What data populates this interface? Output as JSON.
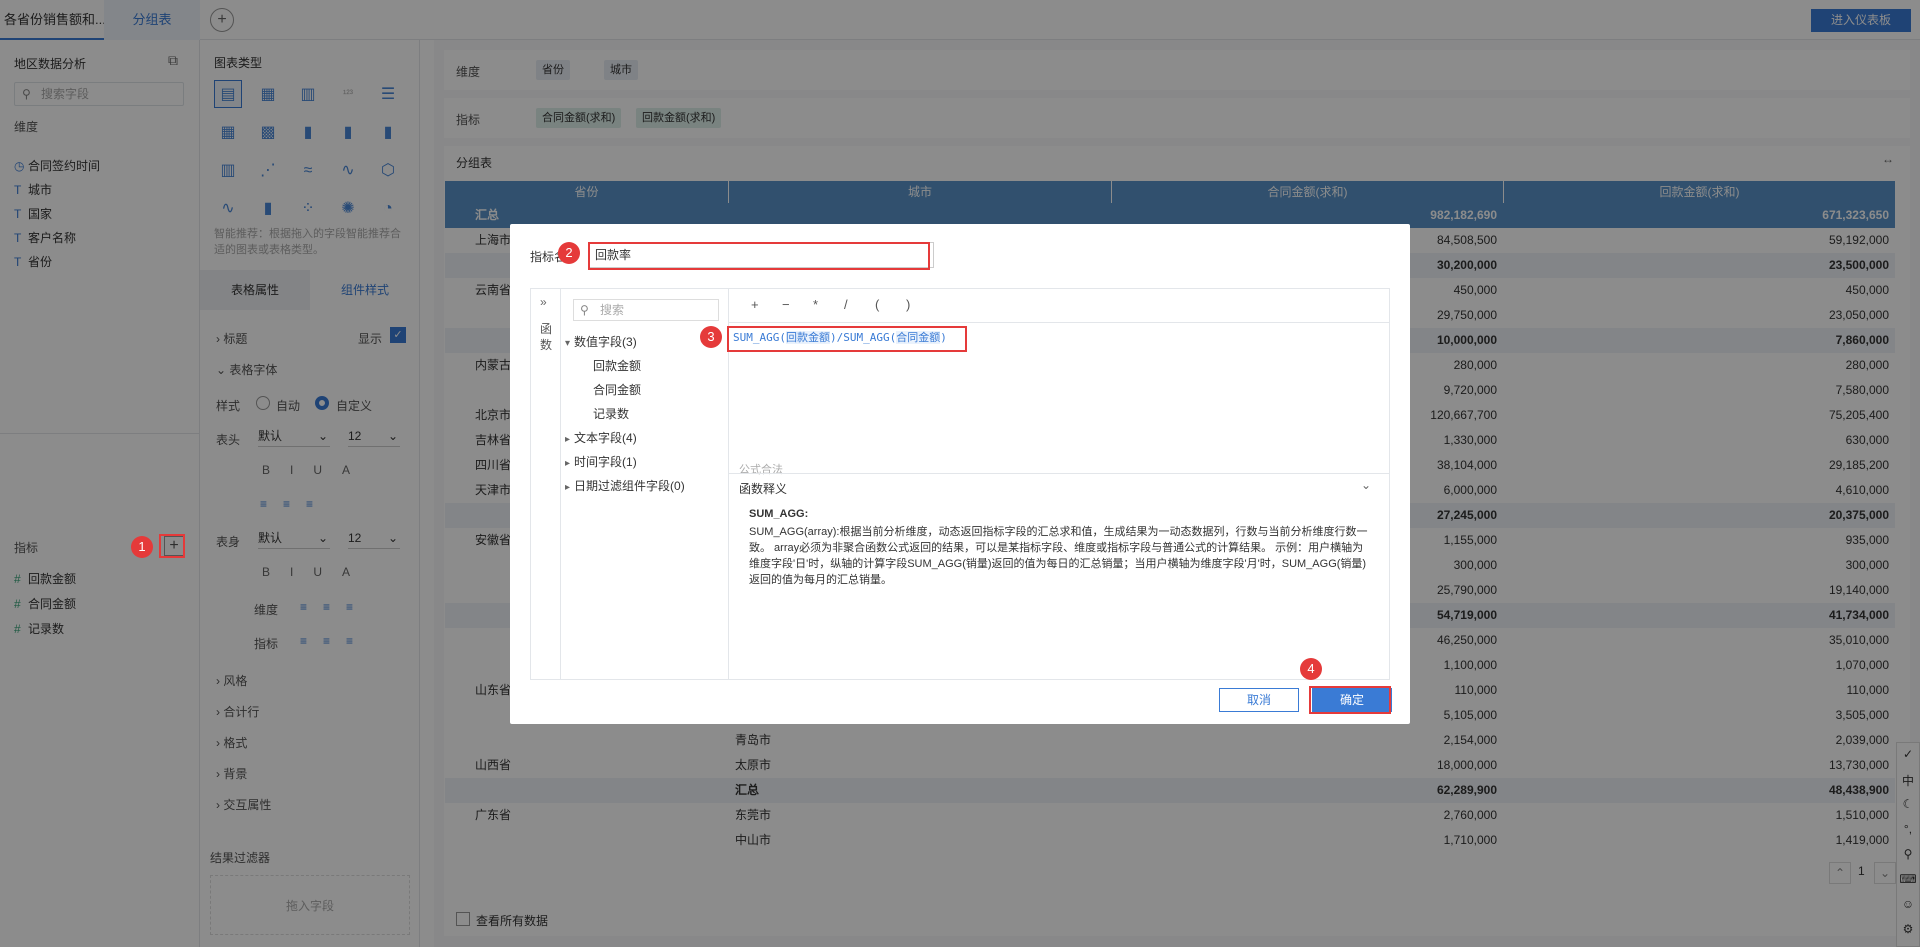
{
  "topbar": {
    "tab_active": "各省份销售额和...",
    "tab_group": "分组表",
    "add_tab": "+",
    "enter_dashboard": "进入仪表板"
  },
  "left_panel": {
    "title": "地区数据分析",
    "search_placeholder": "搜索字段",
    "dimension_header": "维度",
    "dimensions": [
      {
        "icon": "clock-icon",
        "label": "合同签约时间"
      },
      {
        "icon": "text-icon",
        "label": "城市"
      },
      {
        "icon": "text-icon",
        "label": "国家"
      },
      {
        "icon": "text-icon",
        "label": "客户名称"
      },
      {
        "icon": "text-icon",
        "label": "省份"
      }
    ],
    "measure_header": "指标",
    "add_measure": "+",
    "measures": [
      {
        "icon": "hash-icon",
        "label": "回款金额"
      },
      {
        "icon": "hash-icon",
        "label": "合同金额"
      },
      {
        "icon": "hash-icon",
        "label": "记录数"
      }
    ]
  },
  "mid_panel": {
    "chart_type_title": "图表类型",
    "smart_tip": "智能推荐：根据拖入的字段智能推荐合适的图表或表格类型。",
    "tabs": [
      "表格属性",
      "组件样式"
    ],
    "sections": {
      "title": "标题",
      "title_show": "显示",
      "table_font": "表格字体",
      "style": "样式",
      "auto": "自动",
      "custom": "自定义",
      "header": "表头",
      "body": "表身",
      "font_default": "默认",
      "size": "12",
      "dimension": "维度",
      "measure": "指标",
      "style2": "风格",
      "total": "合计行",
      "format": "格式",
      "background": "背景",
      "interaction": "交互属性"
    },
    "filter_title": "结果过滤器",
    "filter_drop": "拖入字段"
  },
  "right_panel": {
    "dimension_label": "维度",
    "dimension_pills": [
      "省份",
      "城市"
    ],
    "measure_label": "指标",
    "measure_pills": [
      "合同金额(求和)",
      "回款金额(求和)"
    ],
    "table_title": "分组表",
    "show_all": "查看所有数据",
    "page": "1"
  },
  "table": {
    "headers": [
      "省份",
      "城市",
      "合同金额(求和)",
      "回款金额(求和)"
    ],
    "rows": [
      {
        "type": "total",
        "p": "汇总",
        "c": "",
        "a": "982,182,690",
        "b": "671,323,650"
      },
      {
        "type": "row",
        "p": "上海市",
        "c": "",
        "a": "84,508,500",
        "b": "59,192,000"
      },
      {
        "type": "sub",
        "p": "",
        "c": "",
        "a": "30,200,000",
        "b": "23,500,000"
      },
      {
        "type": "row",
        "p": "云南省",
        "c": "",
        "a": "450,000",
        "b": "450,000"
      },
      {
        "type": "row",
        "p": "",
        "c": "",
        "a": "29,750,000",
        "b": "23,050,000"
      },
      {
        "type": "sub",
        "p": "",
        "c": "",
        "a": "10,000,000",
        "b": "7,860,000"
      },
      {
        "type": "row",
        "p": "内蒙古",
        "c": "",
        "a": "280,000",
        "b": "280,000"
      },
      {
        "type": "row",
        "p": "",
        "c": "",
        "a": "9,720,000",
        "b": "7,580,000"
      },
      {
        "type": "row",
        "p": "北京市",
        "c": "",
        "a": "120,667,700",
        "b": "75,205,400"
      },
      {
        "type": "row",
        "p": "吉林省",
        "c": "",
        "a": "1,330,000",
        "b": "630,000"
      },
      {
        "type": "row",
        "p": "四川省",
        "c": "",
        "a": "38,104,000",
        "b": "29,185,200"
      },
      {
        "type": "row",
        "p": "天津市",
        "c": "",
        "a": "6,000,000",
        "b": "4,610,000"
      },
      {
        "type": "sub",
        "p": "",
        "c": "",
        "a": "27,245,000",
        "b": "20,375,000"
      },
      {
        "type": "row",
        "p": "安徽省",
        "c": "",
        "a": "1,155,000",
        "b": "935,000"
      },
      {
        "type": "row",
        "p": "",
        "c": "",
        "a": "300,000",
        "b": "300,000"
      },
      {
        "type": "row",
        "p": "",
        "c": "",
        "a": "25,790,000",
        "b": "19,140,000"
      },
      {
        "type": "sub",
        "p": "",
        "c": "",
        "a": "54,719,000",
        "b": "41,734,000"
      },
      {
        "type": "row",
        "p": "",
        "c": "",
        "a": "46,250,000",
        "b": "35,010,000"
      },
      {
        "type": "row",
        "p": "",
        "c": "",
        "a": "1,100,000",
        "b": "1,070,000"
      },
      {
        "type": "row",
        "p": "山东省",
        "c": "",
        "a": "110,000",
        "b": "110,000"
      },
      {
        "type": "row",
        "p": "",
        "c": "",
        "a": "5,105,000",
        "b": "3,505,000"
      },
      {
        "type": "row",
        "p": "",
        "c": "青岛市",
        "a": "2,154,000",
        "b": "2,039,000"
      },
      {
        "type": "row",
        "p": "山西省",
        "c": "太原市",
        "a": "18,000,000",
        "b": "13,730,000"
      },
      {
        "type": "sub",
        "p": "",
        "c": "汇总",
        "a": "62,289,900",
        "b": "48,438,900"
      },
      {
        "type": "row",
        "p": "广东省",
        "c": "东莞市",
        "a": "2,760,000",
        "b": "1,510,000"
      },
      {
        "type": "row",
        "p": "",
        "c": "中山市",
        "a": "1,710,000",
        "b": "1,419,000"
      }
    ]
  },
  "dialog": {
    "name_label": "指标名",
    "name_value": "回款率",
    "expand": "»",
    "func_label": "函数",
    "search_placeholder": "搜索",
    "ops": [
      "+",
      "−",
      "*",
      "/",
      "(",
      ")"
    ],
    "tree": [
      {
        "label": "数值字段(3)",
        "open": true,
        "children": [
          "回款金额",
          "合同金额",
          "记录数"
        ]
      },
      {
        "label": "文本字段(4)"
      },
      {
        "label": "时间字段(1)"
      },
      {
        "label": "日期过滤组件字段(0)"
      }
    ],
    "formula_prefix": "SUM_AGG(",
    "formula_f1": "回款金额",
    "formula_mid": ")/SUM_AGG(",
    "formula_f2": "合同金额",
    "formula_suffix": ")",
    "valid": "公式合法",
    "explain_title": "函数释义",
    "explain_head": "SUM_AGG:",
    "explain_body": "SUM_AGG(array):根据当前分析维度，动态返回指标字段的汇总求和值，生成结果为一动态数据列，行数与当前分析维度行数一致。 array必须为非聚合函数公式返回的结果，可以是某指标字段、维度或指标字段与普通公式的计算结果。 示例：用户横轴为维度字段'日'时，纵轴的计算字段SUM_AGG(销量)返回的值为每日的汇总销量；当用户横轴为维度字段'月'时，SUM_AGG(销量)返回的值为每月的汇总销量。",
    "cancel": "取消",
    "ok": "确定"
  },
  "markers": [
    "1",
    "2",
    "3",
    "4"
  ],
  "right_strip": [
    "✓",
    "中",
    "☾",
    "°,",
    "⚲",
    "⌨",
    "☺",
    "⚙"
  ]
}
